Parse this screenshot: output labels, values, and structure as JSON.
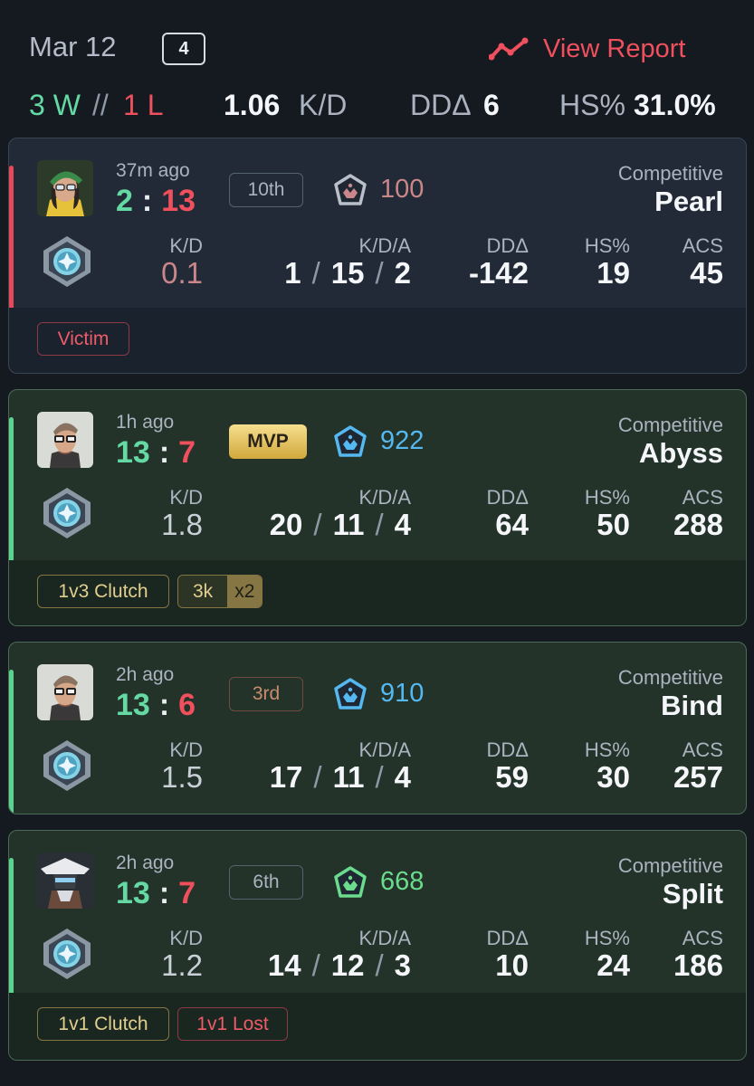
{
  "header": {
    "date": "Mar 12",
    "match_count": "4",
    "view_report_label": "View Report",
    "wins": "3 W",
    "separator": "//",
    "losses": "1 L",
    "kd_value": "1.06",
    "kd_label": "K/D",
    "dd_label": "DDΔ",
    "dd_value": "6",
    "hs_label": "HS%",
    "hs_value": "31.0%"
  },
  "labels": {
    "kd": "K/D",
    "kda": "K/D/A",
    "dd": "DDΔ",
    "hs": "HS%",
    "acs": "ACS"
  },
  "matches": [
    {
      "result": "loss",
      "time_ago": "37m ago",
      "score_team": "2",
      "score_enemy": "13",
      "placement": "10th",
      "rank_value": "100",
      "mode": "Competitive",
      "map": "Pearl",
      "kd": "0.1",
      "kills": "1",
      "deaths": "15",
      "assists": "2",
      "dd": "-142",
      "hs": "19",
      "acs": "45",
      "tags": [
        "Victim"
      ]
    },
    {
      "result": "win",
      "time_ago": "1h ago",
      "score_team": "13",
      "score_enemy": "7",
      "placement": "MVP",
      "rank_value": "922",
      "mode": "Competitive",
      "map": "Abyss",
      "kd": "1.8",
      "kills": "20",
      "deaths": "11",
      "assists": "4",
      "dd": "64",
      "hs": "50",
      "acs": "288",
      "tags": [
        "1v3 Clutch"
      ],
      "multikill": {
        "label": "3k",
        "count": "x2"
      }
    },
    {
      "result": "win",
      "time_ago": "2h ago",
      "score_team": "13",
      "score_enemy": "6",
      "placement": "3rd",
      "rank_value": "910",
      "mode": "Competitive",
      "map": "Bind",
      "kd": "1.5",
      "kills": "17",
      "deaths": "11",
      "assists": "4",
      "dd": "59",
      "hs": "30",
      "acs": "257",
      "tags": []
    },
    {
      "result": "win",
      "time_ago": "2h ago",
      "score_team": "13",
      "score_enemy": "7",
      "placement": "6th",
      "rank_value": "668",
      "mode": "Competitive",
      "map": "Split",
      "kd": "1.2",
      "kills": "14",
      "deaths": "12",
      "assists": "3",
      "dd": "10",
      "hs": "24",
      "acs": "186",
      "tags": [
        "1v1 Clutch",
        "1v1 Lost"
      ]
    }
  ],
  "colors": {
    "win": "#64d9a3",
    "loss": "#f0505d",
    "rank_blue": "#55b8f0",
    "rank_green": "#6bdc8d",
    "rank_muted": "#c9878a"
  },
  "icons": {
    "trend": "trend-line-icon",
    "rank": "rank-emblem-icon",
    "tier": "tier-diamond-icon"
  }
}
